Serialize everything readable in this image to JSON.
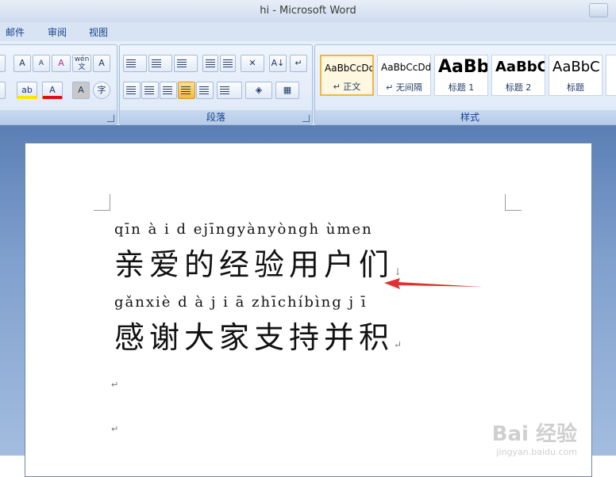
{
  "window": {
    "title": "hi - Microsoft Word"
  },
  "tabs": [
    "邮件",
    "审阅",
    "视图"
  ],
  "ribbon": {
    "font_group": {
      "grow_label": "A",
      "shrink_label": "A",
      "clear_label": "A",
      "phonetic_label": "wén 文",
      "border_char_label": "A",
      "highlight_label": "ab",
      "color_label": "A",
      "char_shade_label": "A",
      "enclose_label": "字"
    },
    "paragraph_group": {
      "label": "段落",
      "sort_label": "A↓"
    },
    "styles_group": {
      "label": "样式",
      "styles": [
        {
          "sample": "AaBbCcDd",
          "name": "↵ 正文",
          "selected": true
        },
        {
          "sample": "AaBbCcDd",
          "name": "↵ 无间隔",
          "selected": false
        },
        {
          "sample": "AaBb",
          "name": "标题 1",
          "selected": false
        },
        {
          "sample": "AaBbC",
          "name": "标题 2",
          "selected": false
        },
        {
          "sample": "AaBbC",
          "name": "标题",
          "selected": false
        }
      ]
    }
  },
  "document": {
    "line1_pinyin": "qīn à  i  d  ejīngyànyòngh ùmen",
    "line1_hanzi": "亲爱的经验用户们",
    "line2_pinyin": "gǎnxiè d à j i ā zhīchíbìng j  ī",
    "line2_hanzi": "感谢大家支持并积",
    "para_mark": "↵",
    "line1_mark": "↓"
  },
  "watermark": {
    "brand": "Bai 经验",
    "url": "jingyan.baidu.com"
  },
  "colors": {
    "arrow": "#e03030",
    "accent_selected": "#f0b542"
  }
}
